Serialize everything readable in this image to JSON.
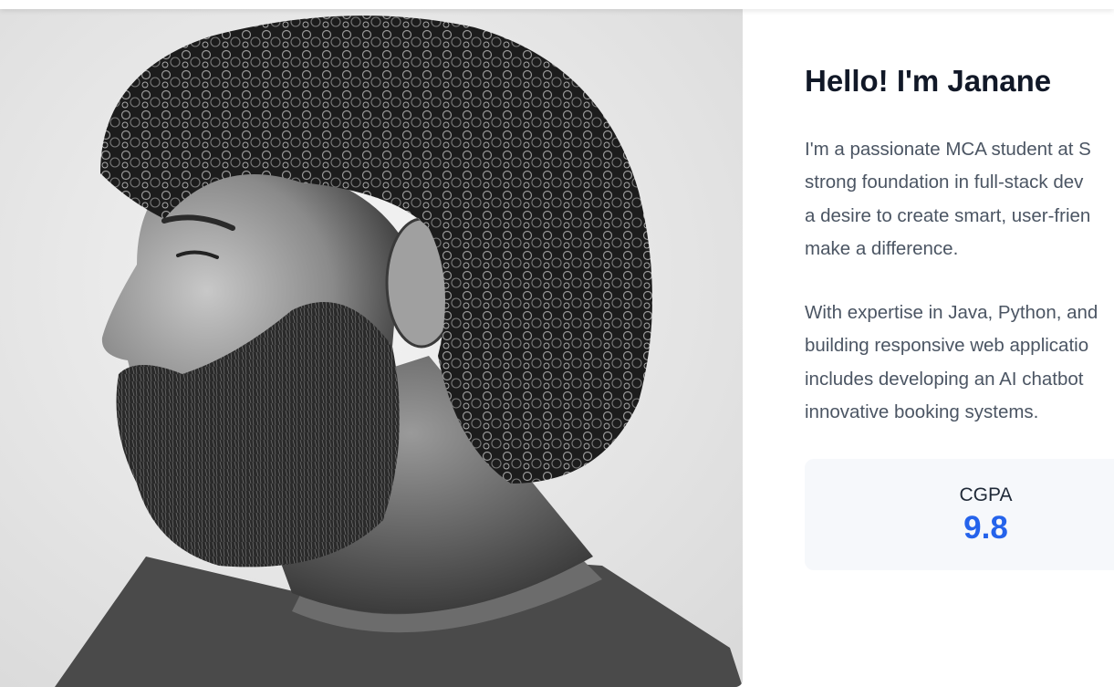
{
  "about": {
    "heading": "Hello! I'm Janane",
    "paragraph1": [
      "I'm a passionate MCA student at S",
      "strong foundation in full-stack dev",
      "a desire to create smart, user-frien",
      "make a difference."
    ],
    "paragraph2": [
      "With expertise in Java, Python, and",
      "building responsive web applicatio",
      "includes developing an AI chatbot",
      "innovative booking systems."
    ],
    "stat": {
      "label": "CGPA",
      "value": "9.8"
    }
  },
  "colors": {
    "heading": "#111827",
    "body_text": "#4b5563",
    "accent": "#2563eb",
    "card_bg": "#f6f8fb"
  },
  "photo": {
    "subject": "profile-portrait",
    "style": "black-and-white"
  }
}
